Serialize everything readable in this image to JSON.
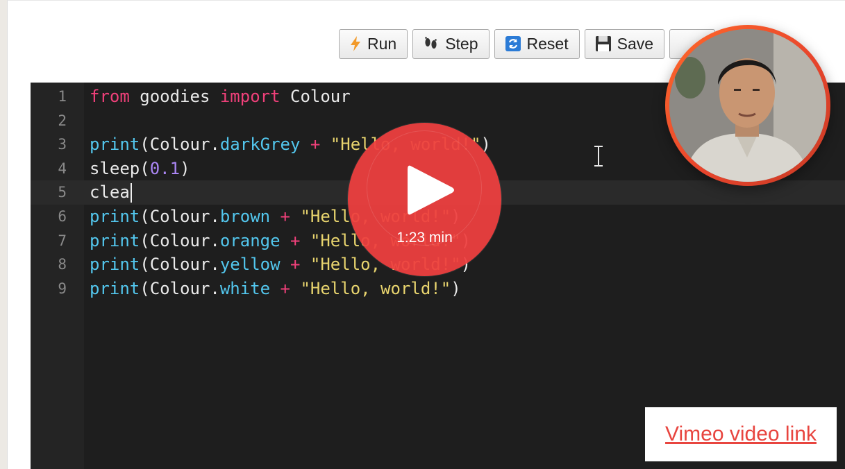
{
  "toolbar": {
    "run_label": "Run",
    "step_label": "Step",
    "reset_label": "Reset",
    "save_label": "Save",
    "icons": [
      "lightning-icon",
      "footprints-icon",
      "reset-icon",
      "save-icon",
      "monitor-icon"
    ]
  },
  "editor": {
    "active_line": 5,
    "lines": [
      {
        "n": "1",
        "tokens": [
          {
            "t": "from",
            "c": "kw"
          },
          {
            "t": " goodies ",
            "c": "plain"
          },
          {
            "t": "import",
            "c": "kw"
          },
          {
            "t": " Colour",
            "c": "plain"
          }
        ]
      },
      {
        "n": "2",
        "tokens": []
      },
      {
        "n": "3",
        "tokens": [
          {
            "t": "print",
            "c": "fn"
          },
          {
            "t": "(Colour.",
            "c": "plain"
          },
          {
            "t": "darkGrey",
            "c": "fn"
          },
          {
            "t": " + ",
            "c": "op"
          },
          {
            "t": "\"Hello, world!\"",
            "c": "str"
          },
          {
            "t": ")",
            "c": "plain"
          }
        ]
      },
      {
        "n": "4",
        "tokens": [
          {
            "t": "sleep(",
            "c": "plain"
          },
          {
            "t": "0.1",
            "c": "num"
          },
          {
            "t": ")",
            "c": "plain"
          }
        ]
      },
      {
        "n": "5",
        "tokens": [
          {
            "t": "clea",
            "c": "plain"
          }
        ]
      },
      {
        "n": "6",
        "tokens": [
          {
            "t": "print",
            "c": "fn"
          },
          {
            "t": "(Colour.",
            "c": "plain"
          },
          {
            "t": "brown",
            "c": "fn"
          },
          {
            "t": " + ",
            "c": "op"
          },
          {
            "t": "\"Hello, world!\"",
            "c": "str"
          },
          {
            "t": ")",
            "c": "plain"
          }
        ]
      },
      {
        "n": "7",
        "tokens": [
          {
            "t": "print",
            "c": "fn"
          },
          {
            "t": "(Colour.",
            "c": "plain"
          },
          {
            "t": "orange",
            "c": "fn"
          },
          {
            "t": " + ",
            "c": "op"
          },
          {
            "t": "\"Hello, world!\"",
            "c": "str"
          },
          {
            "t": ")",
            "c": "plain"
          }
        ]
      },
      {
        "n": "8",
        "tokens": [
          {
            "t": "print",
            "c": "fn"
          },
          {
            "t": "(Colour.",
            "c": "plain"
          },
          {
            "t": "yellow",
            "c": "fn"
          },
          {
            "t": " + ",
            "c": "op"
          },
          {
            "t": "\"Hello, world!\"",
            "c": "str"
          },
          {
            "t": ")",
            "c": "plain"
          }
        ]
      },
      {
        "n": "9",
        "tokens": [
          {
            "t": "print",
            "c": "fn"
          },
          {
            "t": "(Colour.",
            "c": "plain"
          },
          {
            "t": "white",
            "c": "fn"
          },
          {
            "t": " + ",
            "c": "op"
          },
          {
            "t": "\"Hello, world!\"",
            "c": "str"
          },
          {
            "t": ")",
            "c": "plain"
          }
        ]
      }
    ]
  },
  "video": {
    "duration_label": "1:23 min",
    "link_label": "Vimeo video link",
    "play_color": "#ee4040"
  }
}
